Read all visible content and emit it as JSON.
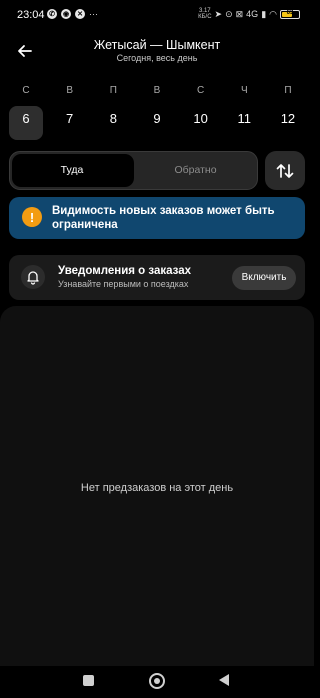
{
  "status_bar": {
    "time": "23:04",
    "left_icons": [
      "whatsapp-icon",
      "notification-icon",
      "app-icon"
    ],
    "speed": "3.17",
    "speed_unit": "КБ/С",
    "network": "4G",
    "battery_level": "63",
    "battery_fill": 0.63,
    "battery_color": "#f5c518"
  },
  "header": {
    "title": "Жетысай — Шымкент",
    "subtitle": "Сегодня, весь день"
  },
  "calendar": {
    "days": [
      {
        "dow": "С",
        "num": "6"
      },
      {
        "dow": "В",
        "num": "7"
      },
      {
        "dow": "П",
        "num": "8"
      },
      {
        "dow": "В",
        "num": "9"
      },
      {
        "dow": "С",
        "num": "10"
      },
      {
        "dow": "Ч",
        "num": "11"
      },
      {
        "dow": "П",
        "num": "12"
      }
    ],
    "selected_index": 0
  },
  "direction": {
    "there_label": "Туда",
    "back_label": "Обратно"
  },
  "alert": {
    "text": "Видимость новых заказов может быть ограничена",
    "color": "#10476f",
    "icon_color": "#f39c12"
  },
  "notifications": {
    "title": "Уведомления о заказах",
    "subtitle": "Узнавайте первыми о поездках",
    "button_label": "Включить"
  },
  "empty_state": {
    "text": "Нет предзаказов на этот день"
  }
}
